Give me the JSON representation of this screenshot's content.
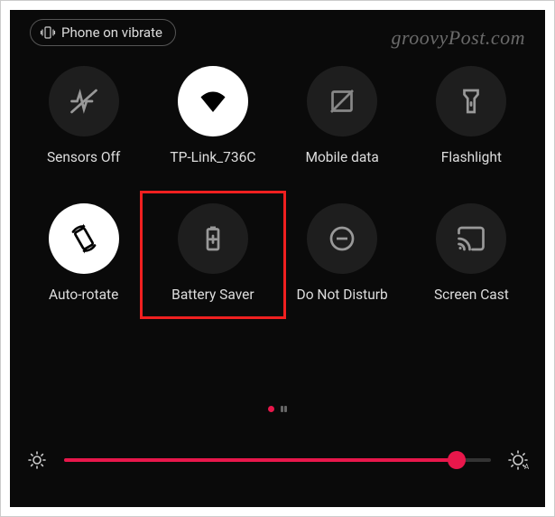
{
  "status": {
    "label": "Phone on vibrate"
  },
  "watermark": "groovyPost.com",
  "tiles": [
    {
      "label": "Sensors Off",
      "active": false
    },
    {
      "label": "TP-Link_736C",
      "active": true
    },
    {
      "label": "Mobile data",
      "active": false
    },
    {
      "label": "Flashlight",
      "active": false
    },
    {
      "label": "Auto-rotate",
      "active": true
    },
    {
      "label": "Battery Saver",
      "active": false,
      "highlighted": true
    },
    {
      "label": "Do Not Disturb",
      "active": false
    },
    {
      "label": "Screen Cast",
      "active": false
    }
  ],
  "pager": {
    "current": 0,
    "total": 2
  },
  "brightness": {
    "percent": 92
  },
  "colors": {
    "accent": "#e8174b",
    "highlight": "#f02020"
  }
}
